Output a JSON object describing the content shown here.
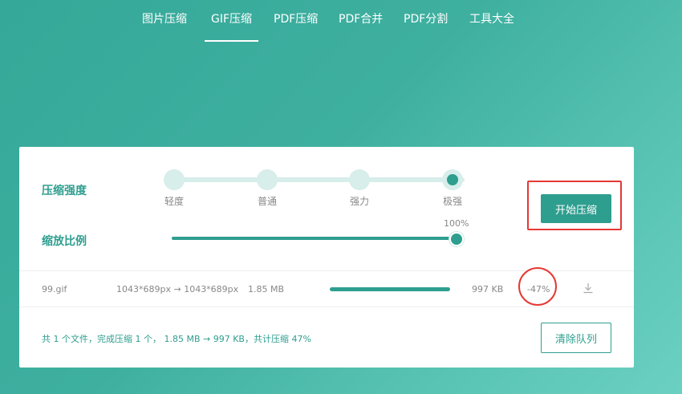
{
  "nav": {
    "items": [
      {
        "label": "图片压缩"
      },
      {
        "label": "GIF压缩"
      },
      {
        "label": "PDF压缩"
      },
      {
        "label": "PDF合并"
      },
      {
        "label": "PDF分割"
      },
      {
        "label": "工具大全"
      }
    ],
    "active": "GIF压缩"
  },
  "compress": {
    "strength_label": "压缩强度",
    "levels": [
      "轻度",
      "普通",
      "强力",
      "极强"
    ],
    "selected_level": "极强",
    "scale_label": "缩放比例",
    "scale_value": "100%",
    "start_button": "开始压缩"
  },
  "file": {
    "name": "99.gif",
    "dimensions": "1043*689px → 1043*689px",
    "original_size": "1.85 MB",
    "progress": 1.0,
    "new_size": "997 KB",
    "ratio": "-47%"
  },
  "footer": {
    "summary": "共 1 个文件，完成压缩 1 个， 1.85 MB → 997 KB，共计压缩 47%",
    "clear_button": "清除队列"
  },
  "colors": {
    "accent": "#2e9e8f",
    "highlight": "#e53935"
  }
}
